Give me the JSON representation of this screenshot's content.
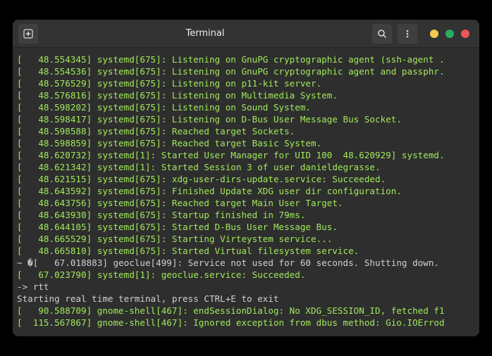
{
  "window": {
    "title": "Terminal"
  },
  "icons": {
    "new_tab": "+",
    "search": "⌕",
    "menu": "⋮"
  },
  "lines": {
    "l0": "[   48.554345] systemd[675]: Listening on GnuPG cryptographic agent (ssh-agent .",
    "l1": "[   48.554536] systemd[675]: Listening on GnuPG cryptographic agent and passphr.",
    "l2": "[   48.576529] systemd[675]: Listening on p11-kit server.",
    "l3": "[   48.576816] systemd[675]: Listening on Multimedia System.",
    "l4": "[   48.598202] systemd[675]: Listening on Sound System.",
    "l5": "[   48.598417] systemd[675]: Listening on D-Bus User Message Bus Socket.",
    "l6": "[   48.598588] systemd[675]: Reached target Sockets.",
    "l7": "[   48.598859] systemd[675]: Reached target Basic System.",
    "l8": "[   48.620732] systemd[1]: Started User Manager for UID 100  48.620929] systemd.",
    "l9": "[   48.621342] systemd[1]: Started Session 3 of user danieldegrasse.",
    "l10": "[   48.621515] systemd[675]: xdg-user-dirs-update.service: Succeeded.",
    "l11": "[   48.643592] systemd[675]: Finished Update XDG user dir configuration.",
    "l12": "[   48.643756] systemd[675]: Reached target Main User Target.",
    "l13": "[   48.643930] systemd[675]: Startup finished in 79ms.",
    "l14": "[   48.644105] systemd[675]: Started D-Bus User Message Bus.",
    "l15": "[   48.665529] systemd[675]: Starting Virteystem service...",
    "l16": "[   48.665810] systemd[675]: Started Virtual filesystem service.",
    "l17": "~ �[   67.018883] geoclue[499]: Service not used for 60 seconds. Shutting down.",
    "l18": "[   67.023790] systemd[1]: geoclue.service: Succeeded.",
    "l19": "-> rtt",
    "l20": "Starting real time terminal, press CTRL+E to exit",
    "l21": "[   90.588709] gnome-shell[467]: endSessionDialog: No XDG_SESSION_ID, fetched f1",
    "l22": "[  115.567867] gnome-shell[467]: Ignored exception from dbus method: Gio.IOErrod"
  }
}
